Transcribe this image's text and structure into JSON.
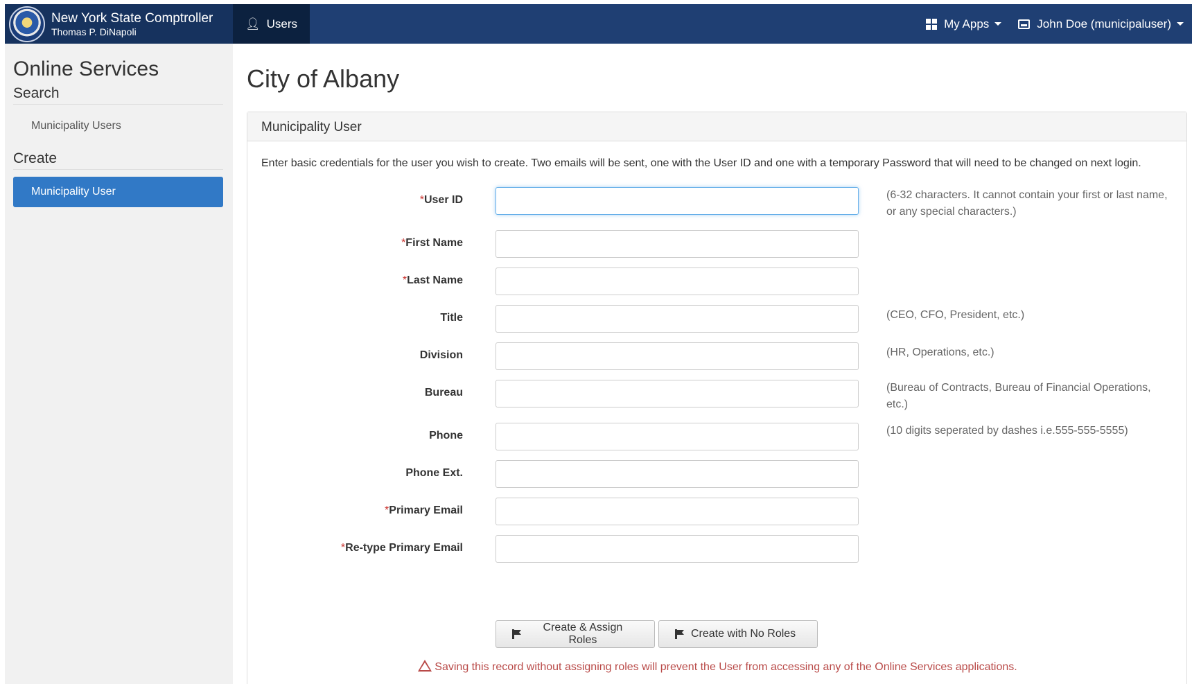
{
  "header": {
    "brand_title": "New York State Comptroller",
    "brand_subtitle": "Thomas P. DiNapoli",
    "nav_users": "Users",
    "my_apps": "My Apps",
    "user": "John Doe (municipaluser)"
  },
  "sidebar": {
    "title": "Online Services",
    "search_heading": "Search",
    "search_link": "Municipality Users",
    "create_heading": "Create",
    "create_link": "Municipality User"
  },
  "main": {
    "page_title": "City of Albany",
    "panel_title": "Municipality User",
    "intro": "Enter basic credentials for the user you wish to create. Two emails will be sent, one with the User ID and one with a temporary Password that will need to be changed on next login."
  },
  "form": {
    "required_mark": "*",
    "fields": [
      {
        "label": "User ID",
        "required": true,
        "hint": "(6-32 characters. It cannot contain your first or last name, or any special characters.)",
        "value": ""
      },
      {
        "label": "First Name",
        "required": true,
        "hint": "",
        "value": ""
      },
      {
        "label": "Last Name",
        "required": true,
        "hint": "",
        "value": ""
      },
      {
        "label": "Title",
        "required": false,
        "hint": "(CEO, CFO, President, etc.)",
        "value": ""
      },
      {
        "label": "Division",
        "required": false,
        "hint": "(HR, Operations, etc.)",
        "value": ""
      },
      {
        "label": "Bureau",
        "required": false,
        "hint": "(Bureau of Contracts, Bureau of Financial Operations, etc.)",
        "value": ""
      },
      {
        "label": "Phone",
        "required": false,
        "hint": "(10 digits seperated by dashes i.e.555-555-5555)",
        "value": ""
      },
      {
        "label": "Phone Ext.",
        "required": false,
        "hint": "",
        "value": ""
      },
      {
        "label": "Primary Email",
        "required": true,
        "hint": "",
        "value": ""
      },
      {
        "label": "Re-type Primary Email",
        "required": true,
        "hint": "",
        "value": ""
      }
    ],
    "create_assign_label": "Create & Assign Roles",
    "create_no_roles_label": "Create with No Roles",
    "warning": "Saving this record without assigning roles will prevent the User from accessing any of the Online Services applications."
  },
  "colors": {
    "navbar": "#1f3f73",
    "active_nav": "#0c213f",
    "sidebar_active": "#3179c6",
    "warning": "#b94a48",
    "required": "#c9302c"
  }
}
